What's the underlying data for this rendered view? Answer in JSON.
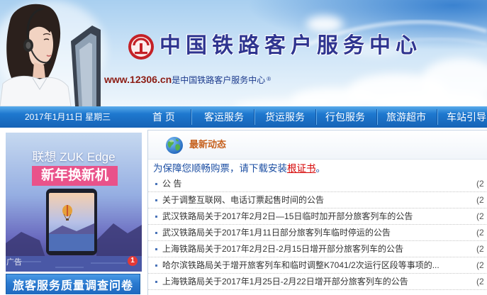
{
  "header": {
    "site_title": "中国铁路客户服务中心",
    "url_text": "www.12306.cn",
    "url_suffix": "是中国铁路客户服务中心",
    "reg_mark": "®"
  },
  "nav": {
    "date": "2017年1月11日 星期三",
    "items": [
      {
        "label": "首 页"
      },
      {
        "label": "客运服务"
      },
      {
        "label": "货运服务"
      },
      {
        "label": "行包服务"
      },
      {
        "label": "旅游超市"
      },
      {
        "label": "车站引导"
      }
    ]
  },
  "ad": {
    "brand": "联想 ZUK Edge",
    "slogan": "新年换新机",
    "label": "广告",
    "slide_badge": "1"
  },
  "survey_button": {
    "label": "旅客服务质量调查问卷"
  },
  "news": {
    "title": "最新动态",
    "notice": {
      "prefix": "为保障您顺畅购票，请下载安装",
      "link": "根证书",
      "suffix": "。"
    },
    "items": [
      {
        "text": "公 告",
        "date": "(2"
      },
      {
        "text": "关于调整互联网、电话订票起售时间的公告",
        "date": "(2"
      },
      {
        "text": "武汉铁路局关于2017年2月2日—15日临时加开部分旅客列车的公告",
        "date": "(2"
      },
      {
        "text": "武汉铁路局关于2017年1月11日部分旅客列车临时停运的公告",
        "date": "(2"
      },
      {
        "text": "上海铁路局关于2017年2月2日-2月15日增开部分旅客列车的公告",
        "date": "(2"
      },
      {
        "text": "哈尔滨铁路局关于增开旅客列车和临时调整K7041/2次运行区段等事项的...",
        "date": "(2"
      },
      {
        "text": "上海铁路局关于2017年1月25日-2月22日增开部分旅客列车的公告",
        "date": "(2"
      }
    ]
  },
  "icons": {
    "logo": "china-railway-logo-icon",
    "news": "globe-icon",
    "list_bullet": "square-bullet-icon"
  },
  "colors": {
    "nav_blue": "#1e78cf",
    "brand_red": "#c42127",
    "news_title": "#c6611e",
    "link_red": "#d50000",
    "notice_blue": "#1d4fa3",
    "survey_blue": "#2a7ad0",
    "ad_pink": "#e9528a",
    "url_red": "#8c1c13",
    "url_blue": "#1b3a8c",
    "title_navy": "#2f3590"
  }
}
